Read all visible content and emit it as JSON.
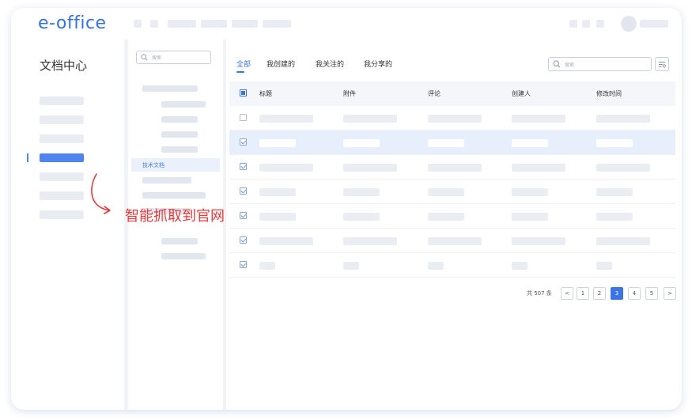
{
  "app": {
    "logo": "e-office"
  },
  "nav": {
    "title": "文档中心"
  },
  "tree": {
    "search_placeholder": "搜索",
    "selected_item": "技术文档"
  },
  "tabs": [
    {
      "label": "全部"
    },
    {
      "label": "我创建的"
    },
    {
      "label": "我关注的"
    },
    {
      "label": "我分享的"
    }
  ],
  "search": {
    "placeholder": "搜索"
  },
  "table": {
    "headers": [
      "标题",
      "附件",
      "评论",
      "创建人",
      "修改时间"
    ]
  },
  "pagination": {
    "total": "共 507 条",
    "prev": "<",
    "pages": [
      "1",
      "2",
      "3",
      "4",
      "5"
    ],
    "current": "3",
    "next": ">"
  },
  "annotation": {
    "text": "智能抓取到官网"
  },
  "colors": {
    "accent": "#3a74e6",
    "annotation": "#e23a3a"
  }
}
